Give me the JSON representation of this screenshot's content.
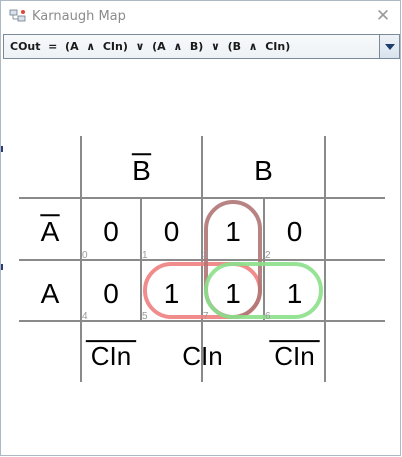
{
  "window": {
    "title": "Karnaugh Map",
    "close_icon": "close-icon",
    "app_icon": "karnaugh-app-icon"
  },
  "expression": {
    "selected": "COut  =  (A  ∧  CIn)  ∨  (A  ∧  B)  ∨  (B  ∧  CIn)"
  },
  "kmap": {
    "top_headers": [
      {
        "label": "B",
        "negated": true
      },
      {
        "label": "B",
        "negated": false
      }
    ],
    "row_headers": [
      {
        "label": "A",
        "negated": true
      },
      {
        "label": "A",
        "negated": false
      }
    ],
    "bottom_headers": [
      {
        "label": "CIn",
        "negated": true
      },
      {
        "label": "CIn",
        "negated": false
      },
      {
        "label": "CIn",
        "negated": true
      }
    ],
    "cells": [
      [
        {
          "value": "0",
          "index": "0"
        },
        {
          "value": "0",
          "index": "1"
        },
        {
          "value": "1",
          "index": "3"
        },
        {
          "value": "0",
          "index": "2"
        }
      ],
      [
        {
          "value": "0",
          "index": "4"
        },
        {
          "value": "1",
          "index": "5"
        },
        {
          "value": "1",
          "index": "7"
        },
        {
          "value": "1",
          "index": "6"
        }
      ]
    ],
    "groups": [
      {
        "name": "group-a-cin",
        "color": "#f08080",
        "cells": [
          [
            1,
            1
          ],
          [
            1,
            2
          ]
        ]
      },
      {
        "name": "group-b-cin",
        "color": "#b07676",
        "cells": [
          [
            0,
            2
          ],
          [
            1,
            2
          ]
        ]
      },
      {
        "name": "group-a-b",
        "color": "#8be08b",
        "cells": [
          [
            1,
            2
          ],
          [
            1,
            3
          ]
        ]
      }
    ],
    "colors": {
      "grid": "#8a8a8a",
      "text": "#000000",
      "index": "#999999"
    }
  }
}
